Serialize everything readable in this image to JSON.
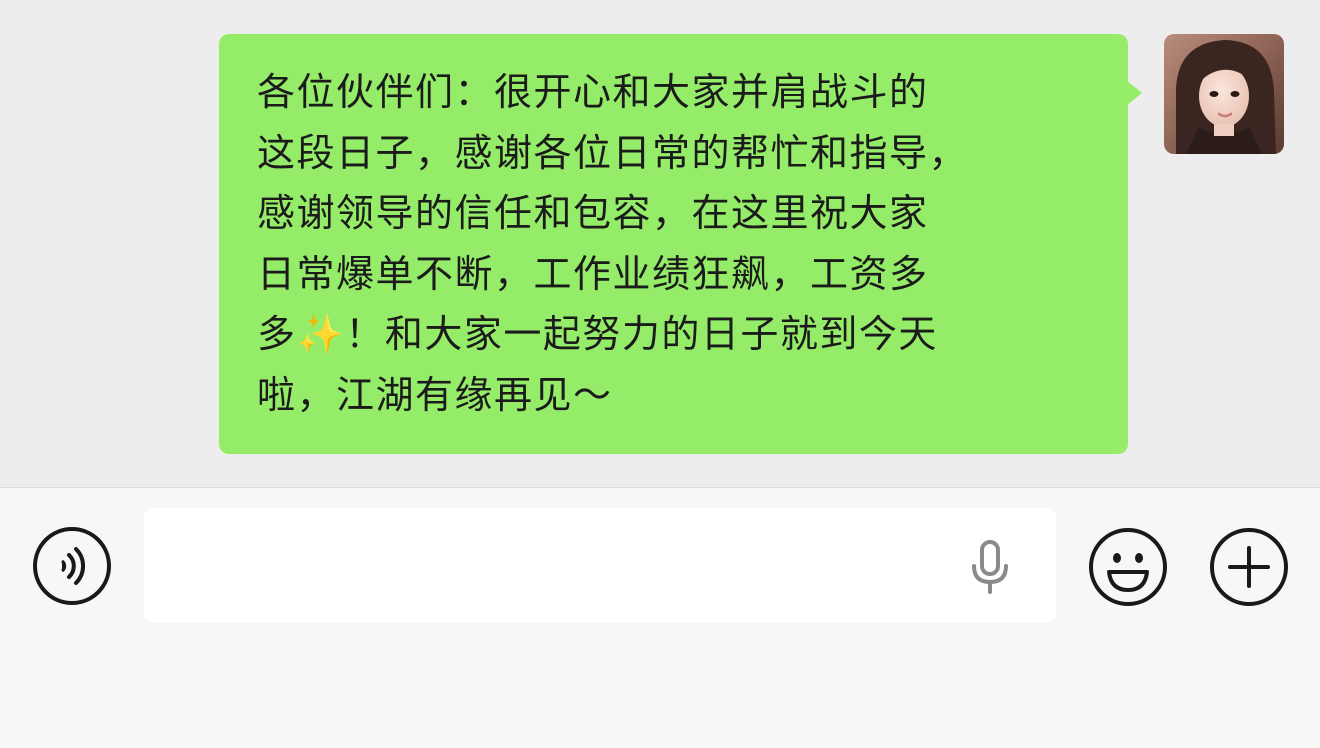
{
  "chat": {
    "message": {
      "lines": [
        "各位伙伴们：很开心和大家并肩战斗的",
        "这段日子，感谢各位日常的帮忙和指导，",
        "感谢领导的信任和包容，在这里祝大家",
        "日常爆单不断，工作业绩狂飙，工资多"
      ],
      "line5_before": "多",
      "sparkle": "✨",
      "line5_after": "！和大家一起努力的日子就到今天",
      "line6": "啦，江湖有缘再见～"
    },
    "avatar_icon": "user-avatar-photo"
  },
  "input_bar": {
    "voice_icon": "voice-toggle-icon",
    "text_value": "",
    "mic_icon": "microphone-icon",
    "emoji_icon": "emoji-icon",
    "plus_icon": "plus-icon"
  },
  "colors": {
    "chat_background": "#ededed",
    "bubble_green": "#95ec69",
    "input_bar_background": "#f7f7f7"
  }
}
